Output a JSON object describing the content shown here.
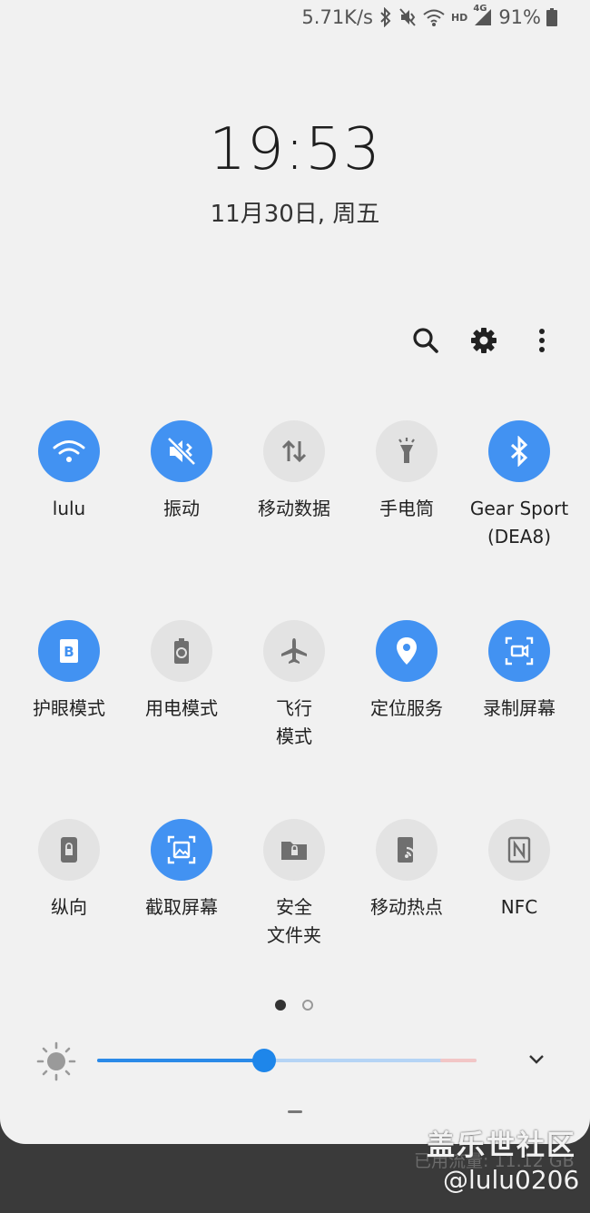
{
  "status": {
    "speed": "5.71K/s",
    "battery": "91%",
    "icons": [
      "bluetooth-icon",
      "vibrate-icon",
      "wifi-icon",
      "hd-icon",
      "4g-signal-icon",
      "battery-icon"
    ],
    "hd": "HD",
    "net": "4G"
  },
  "clock": {
    "time": "19:53",
    "date": "11月30日, 周五"
  },
  "top_actions": [
    "search-icon",
    "gear-icon",
    "more-vert-icon"
  ],
  "tiles": [
    {
      "label": "lulu",
      "icon": "wifi-icon",
      "on": true
    },
    {
      "label": "振动",
      "icon": "vibrate-icon",
      "on": true
    },
    {
      "label": "移动数据",
      "icon": "mobile-data-icon",
      "on": false
    },
    {
      "label": "手电筒",
      "icon": "flashlight-icon",
      "on": false
    },
    {
      "label": "Gear Sport\n(DEA8)",
      "icon": "bluetooth-icon",
      "on": true
    },
    {
      "label": "护眼模式",
      "icon": "blue-light-filter-icon",
      "on": true
    },
    {
      "label": "用电模式",
      "icon": "power-mode-icon",
      "on": false
    },
    {
      "label": "飞行\n模式",
      "icon": "airplane-icon",
      "on": false
    },
    {
      "label": "定位服务",
      "icon": "location-icon",
      "on": true
    },
    {
      "label": "录制屏幕",
      "icon": "screen-record-icon",
      "on": true
    },
    {
      "label": "纵向",
      "icon": "portrait-lock-icon",
      "on": false
    },
    {
      "label": "截取屏幕",
      "icon": "screenshot-icon",
      "on": true
    },
    {
      "label": "安全\n文件夹",
      "icon": "secure-folder-icon",
      "on": false
    },
    {
      "label": "移动热点",
      "icon": "hotspot-icon",
      "on": false
    },
    {
      "label": "NFC",
      "icon": "nfc-icon",
      "on": false
    }
  ],
  "pages": {
    "count": 2,
    "current": 1
  },
  "brightness": {
    "level": 0.44,
    "icon": "sun-icon"
  },
  "usage": "已用流量: 11.12 GB",
  "watermark": {
    "line1": "盖乐世社区",
    "line2": "@lulu0206"
  },
  "colors": {
    "accent": "#4292f2",
    "off": "#e3e3e3",
    "panel": "#f1f1f1"
  }
}
